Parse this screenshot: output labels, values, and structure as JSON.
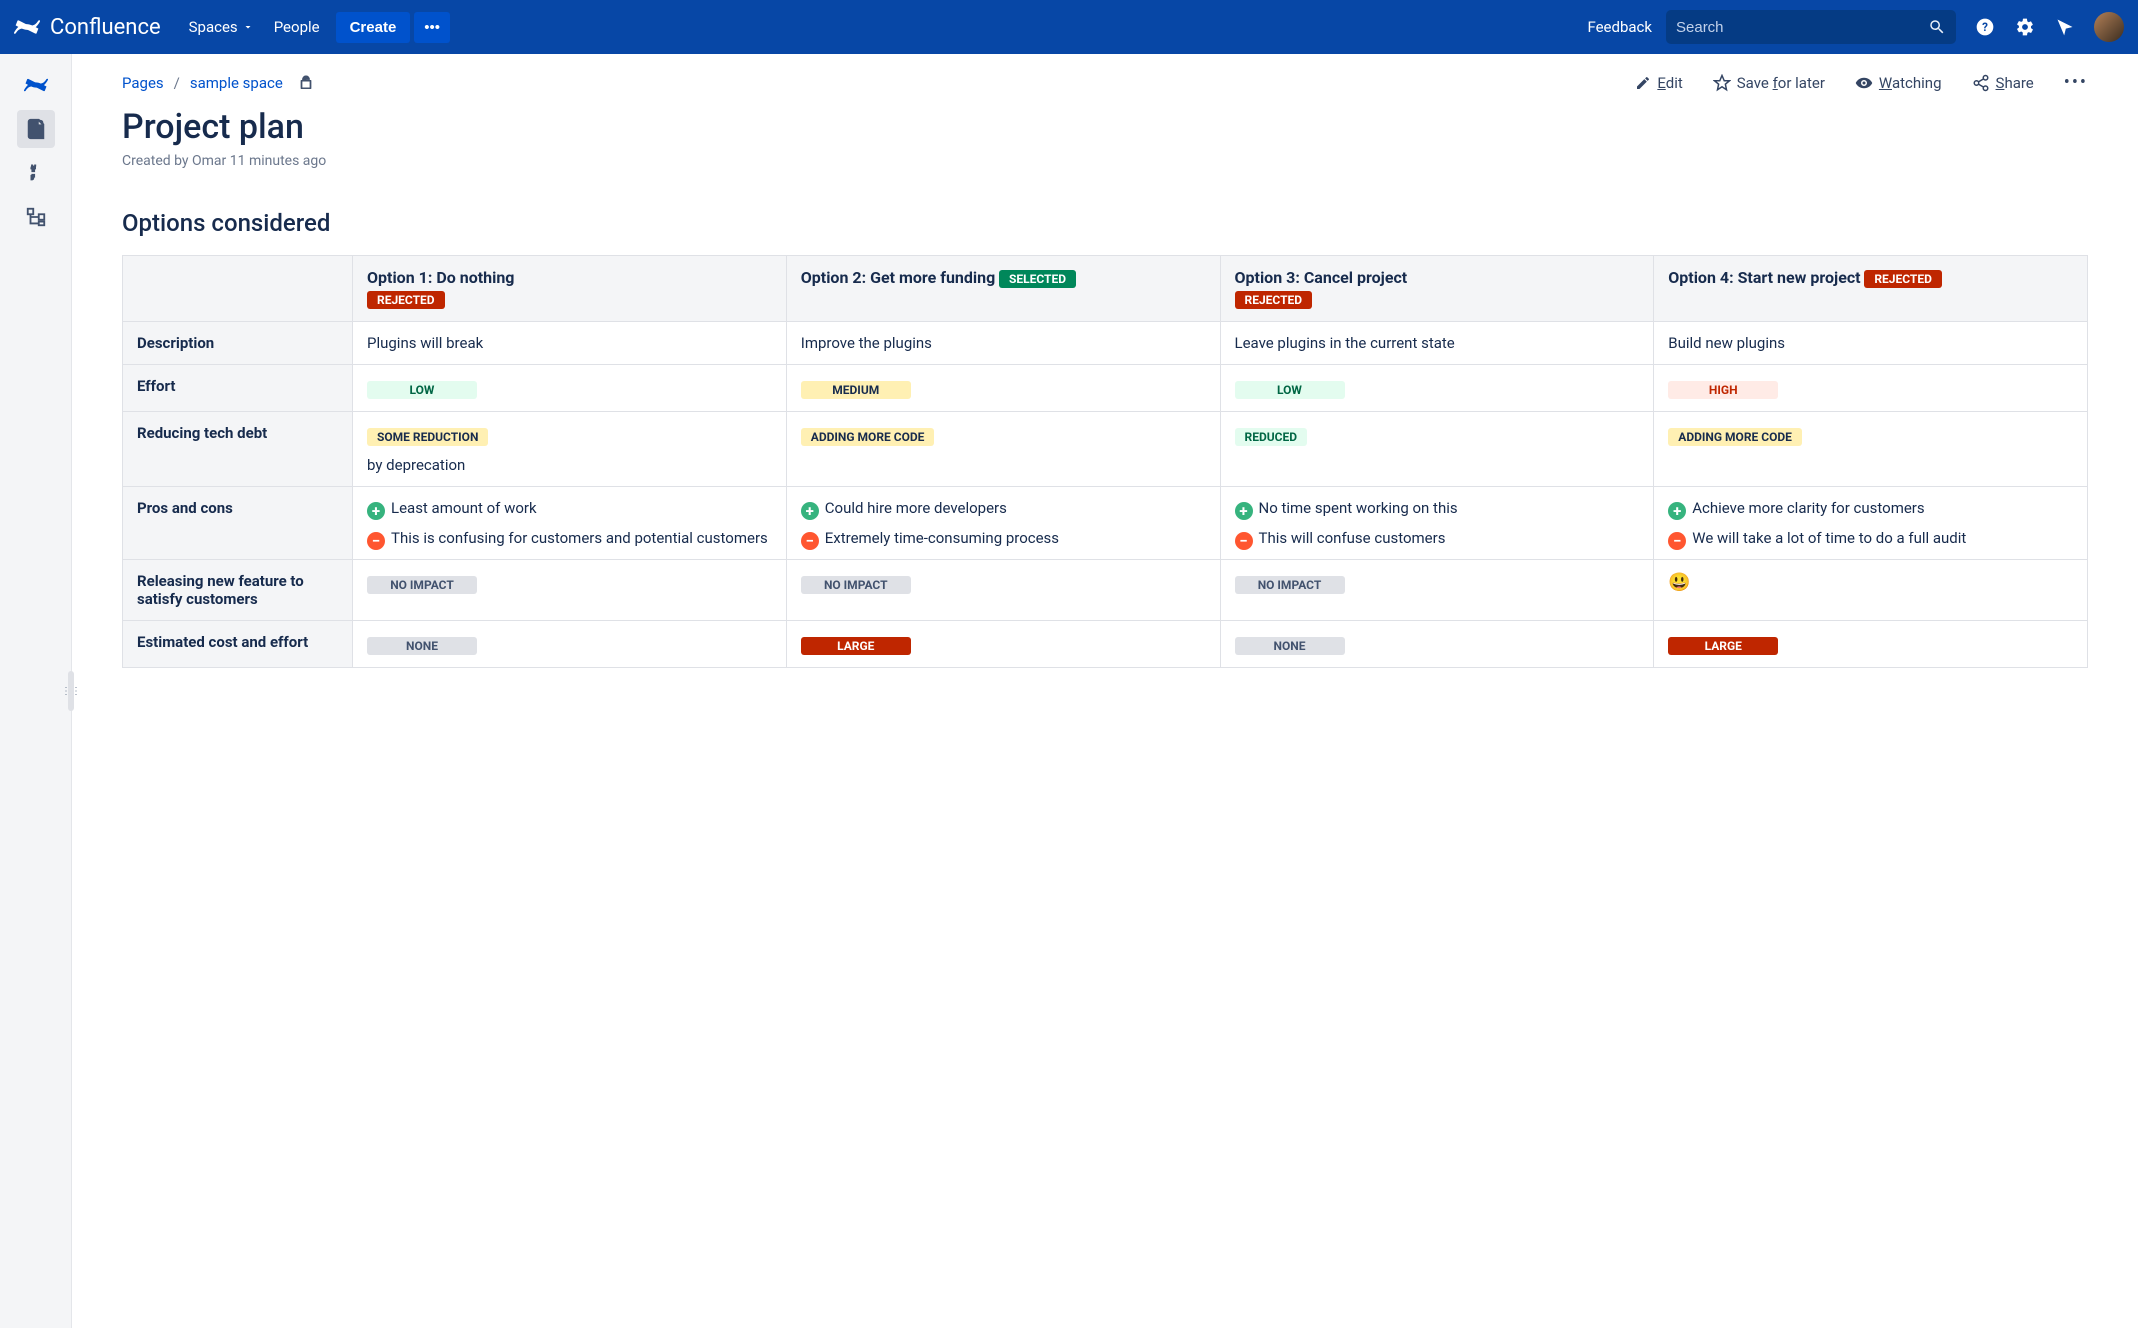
{
  "nav": {
    "product": "Confluence",
    "spaces": "Spaces",
    "people": "People",
    "create": "Create",
    "feedback": "Feedback",
    "search_placeholder": "Search"
  },
  "breadcrumbs": {
    "pages": "Pages",
    "space": "sample space"
  },
  "actions": {
    "edit": "Edit",
    "save": "Save for later",
    "watching": "Watching",
    "share": "Share"
  },
  "page": {
    "title": "Project plan",
    "meta": "Created by Omar 11 minutes ago",
    "section": "Options considered"
  },
  "rows": {
    "description": "Description",
    "effort": "Effort",
    "techdebt": "Reducing tech debt",
    "proscons": "Pros and cons",
    "releasing": "Releasing new feature to satisfy customers",
    "cost": "Estimated cost and effort"
  },
  "options": [
    {
      "title": "Option 1: Do nothing",
      "status": "REJECTED",
      "status_type": "red",
      "description": "Plugins will break",
      "effort": "LOW",
      "effort_type": "low",
      "techdebt": "SOME REDUCTION",
      "techdebt_type": "yellow",
      "techdebt_note": "by deprecation",
      "pros": "Least amount of work",
      "cons": "This is confusing for customers and potential customers",
      "releasing": "NO IMPACT",
      "releasing_type": "grey",
      "cost": "NONE",
      "cost_type": "grey"
    },
    {
      "title": "Option 2: Get more funding",
      "status": "SELECTED",
      "status_type": "green",
      "description": "Improve the plugins",
      "effort": "MEDIUM",
      "effort_type": "med",
      "techdebt": "ADDING MORE CODE",
      "techdebt_type": "yellow",
      "techdebt_note": "",
      "pros": "Could hire more developers",
      "cons": "Extremely time-consuming process",
      "releasing": "NO IMPACT",
      "releasing_type": "grey",
      "cost": "LARGE",
      "cost_type": "darkred"
    },
    {
      "title": "Option 3: Cancel project",
      "status": "REJECTED",
      "status_type": "red",
      "description": "Leave plugins in the current state",
      "effort": "LOW",
      "effort_type": "low",
      "techdebt": "REDUCED",
      "techdebt_type": "teal",
      "techdebt_note": "",
      "pros": "No time spent working on this",
      "cons": "This will confuse customers",
      "releasing": "NO IMPACT",
      "releasing_type": "grey",
      "cost": "NONE",
      "cost_type": "grey"
    },
    {
      "title": "Option 4: Start new project",
      "status": "REJECTED",
      "status_type": "red",
      "description": "Build new plugins",
      "effort": "HIGH",
      "effort_type": "high",
      "techdebt": "ADDING MORE CODE",
      "techdebt_type": "yellow",
      "techdebt_note": "",
      "pros": "Achieve more clarity for customers",
      "cons": "We will take a lot of time to do a full audit",
      "releasing": "😃",
      "releasing_type": "emoji",
      "cost": "LARGE",
      "cost_type": "darkred"
    }
  ]
}
